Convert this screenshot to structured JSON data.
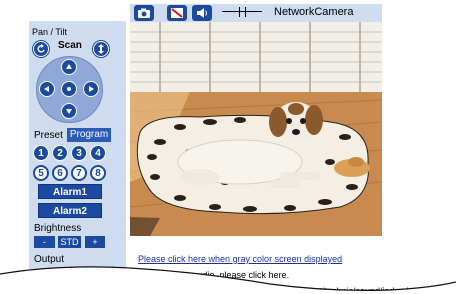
{
  "toolbar": {
    "title": "NetworkCamera",
    "icons": [
      "camera-icon",
      "mute-icon",
      "speaker-icon"
    ]
  },
  "sidebar": {
    "pan_tilt_label": "Pan / Tilt",
    "scan_label": "Scan",
    "preset_label": "Preset",
    "program_label": "Program",
    "presets": [
      "1",
      "2",
      "3",
      "4",
      "5",
      "6",
      "7",
      "8"
    ],
    "alarm1_label": "Alarm1",
    "alarm2_label": "Alarm2",
    "brightness_label": "Brightness",
    "brightness_minus": "-",
    "brightness_std": "STD",
    "brightness_plus": "+",
    "output_label": "Output"
  },
  "links": {
    "gray_screen": "Please click here when gray color screen displayed",
    "audio_partial": "no audio, please click here.",
    "url_partial": "om/support/technic/sound/index.html"
  },
  "colors": {
    "panel_bg": "#cfdcef",
    "button_blue": "#1b4aa0",
    "link_blue": "#1a2fa8"
  }
}
